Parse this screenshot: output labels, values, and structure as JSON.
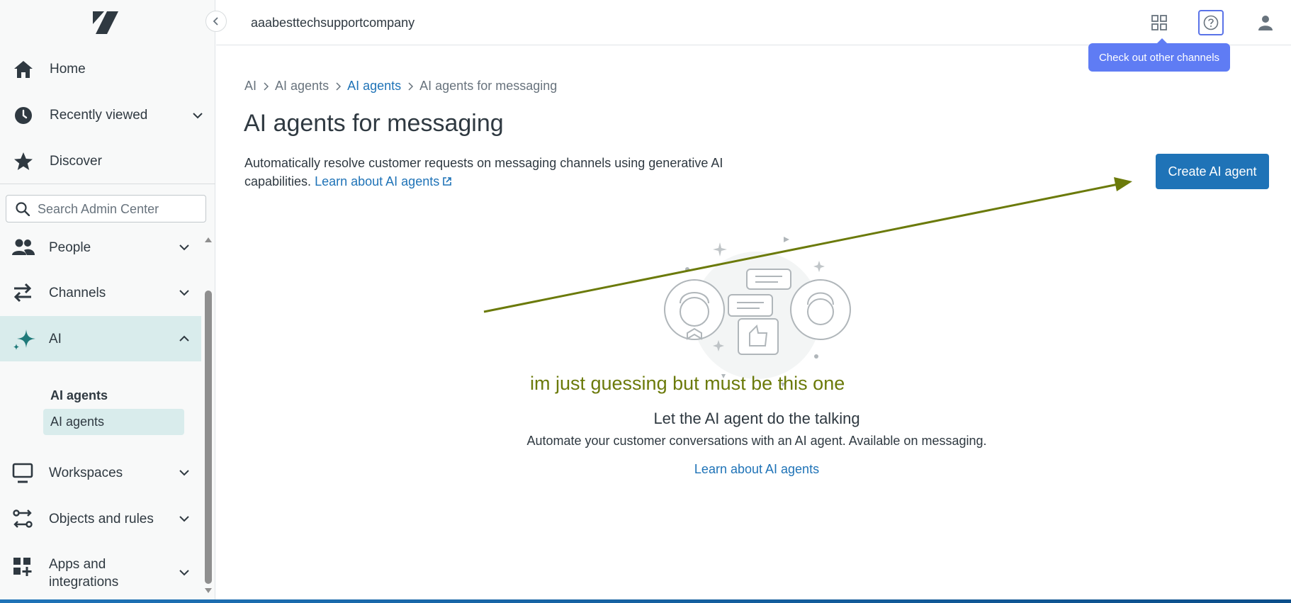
{
  "header": {
    "account_name": "aaabesttechsupportcompany",
    "tooltip": "Check out other channels",
    "icons": [
      "zendesk-logo-icon",
      "apps-grid-icon",
      "help-icon",
      "user-icon"
    ]
  },
  "sidebar": {
    "top_items": [
      {
        "label": "Home",
        "icon": "home-icon"
      },
      {
        "label": "Recently viewed",
        "icon": "clock-icon"
      },
      {
        "label": "Discover",
        "icon": "star-icon"
      }
    ],
    "search": {
      "placeholder": "Search Admin Center",
      "value": ""
    },
    "items": [
      {
        "label": "People",
        "icon": "people-icon"
      },
      {
        "label": "Channels",
        "icon": "channels-icon"
      },
      {
        "label": "AI",
        "icon": "sparkle-icon",
        "active": true
      },
      {
        "label": "Workspaces",
        "icon": "monitor-icon"
      },
      {
        "label": "Objects and rules",
        "icon": "objects-icon"
      },
      {
        "label_line1": "Apps and",
        "label_line2": "integrations",
        "icon": "apps-plus-icon"
      }
    ],
    "ai_section": {
      "heading": "AI agents",
      "sub_item": "AI agents"
    }
  },
  "main": {
    "breadcrumb": [
      "AI",
      "AI agents",
      "AI agents",
      "AI agents for messaging"
    ],
    "title": "AI agents for messaging",
    "description": "Automatically resolve customer requests on messaging channels using generative AI capabilities.",
    "description_link": "Learn about AI agents",
    "create_button": "Create AI agent",
    "empty_state": {
      "title": "Let the AI agent do the talking",
      "description": "Automate your customer conversations with an AI agent. Available on messaging.",
      "link": "Learn about AI agents"
    },
    "annotation": "im just guessing but must be this one"
  },
  "colors": {
    "primary": "#1f73b7",
    "active_bg": "#d9ecec",
    "tooltip": "#5f7cf4",
    "annotation": "#6b7a0a"
  }
}
